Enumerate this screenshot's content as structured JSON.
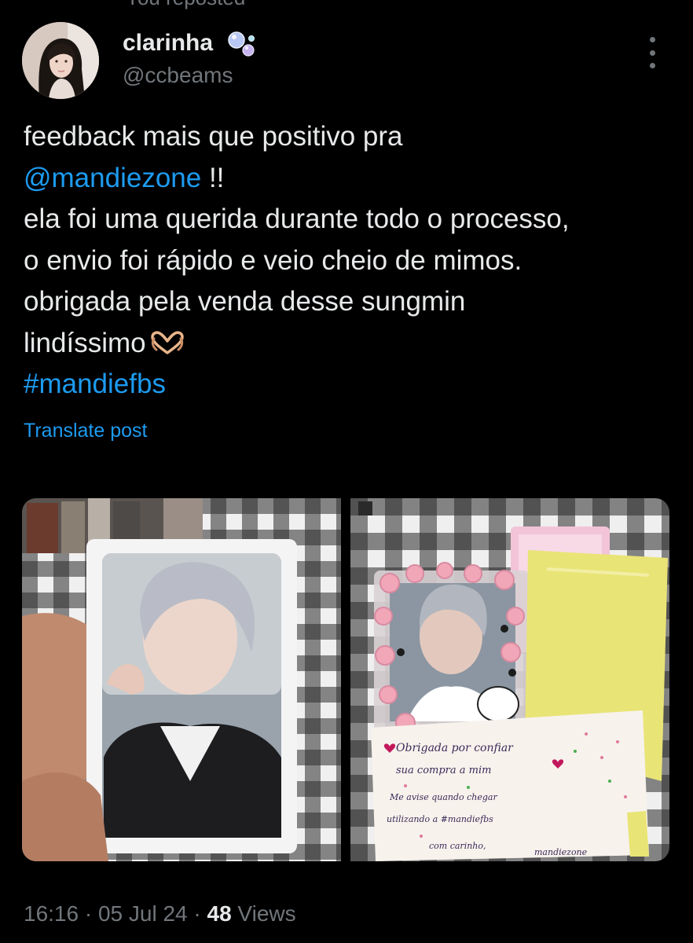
{
  "repost_header": {
    "text": "You reposted"
  },
  "author": {
    "display_name": "clarinha",
    "handle": "@ccbeams",
    "name_icon": "bubbles-icon",
    "avatar_icon": "avatar"
  },
  "menu": {
    "icon": "more-options-icon"
  },
  "post": {
    "line1": "feedback mais que positivo pra",
    "mention": "@mandiezone",
    "mention_suffix": " !!",
    "line3": "ela foi uma querida durante todo o processo,",
    "line4": "o envio foi rápido e veio cheio de mimos.",
    "line5": "obrigada pela venda desse sungmin",
    "line6": "lindíssimo",
    "line6_icon": "heart-hands-icon",
    "hashtag": "#mandiefbs"
  },
  "translate": {
    "label": "Translate post"
  },
  "media": {
    "left_alt": "photocard-photo",
    "right_alt": "package-photo",
    "note": {
      "line1": "Obrigada por confiar",
      "line2": "sua compra a mim",
      "line3": "Me avise quando chegar",
      "line4": "utilizando a #mandiefbs",
      "line5": "com carinho,",
      "line6": "mandiezone"
    }
  },
  "meta": {
    "time": "16:16",
    "separator": " · ",
    "date": "05 Jul 24",
    "views_count": "48",
    "views_label": " Views"
  },
  "colors": {
    "accent": "#1d9bf0",
    "muted": "#71767b",
    "text": "#e7e9ea",
    "background": "#000000"
  }
}
